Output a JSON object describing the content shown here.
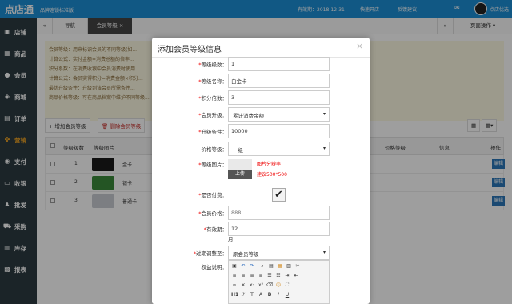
{
  "app": {
    "logo": "点店通",
    "subtitle": "品牌连锁标准版",
    "expiry": "有效期：2018-12-31",
    "quick_open": "快速开店",
    "feedback": "反馈建议",
    "user": "点店优选"
  },
  "sidebar": {
    "items": [
      {
        "label": "店铺",
        "icon": "shop-icon"
      },
      {
        "label": "商品",
        "icon": "goods-icon"
      },
      {
        "label": "会员",
        "icon": "member-icon"
      },
      {
        "label": "商城",
        "icon": "mall-icon"
      },
      {
        "label": "订单",
        "icon": "order-icon"
      },
      {
        "label": "营销",
        "icon": "marketing-icon"
      },
      {
        "label": "支付",
        "icon": "pay-icon"
      },
      {
        "label": "收银",
        "icon": "cashier-icon"
      },
      {
        "label": "批发",
        "icon": "wholesale-icon"
      },
      {
        "label": "采购",
        "icon": "purchase-icon"
      },
      {
        "label": "库存",
        "icon": "stock-icon"
      },
      {
        "label": "报表",
        "icon": "report-icon"
      }
    ],
    "active_color": "#f5a623"
  },
  "tabs": {
    "back": "«",
    "nav": "导航",
    "active": "会员等级",
    "close": "×",
    "forward": "»",
    "page_ops": "页面操作"
  },
  "info": {
    "lines": [
      "会员等级：用来标识会员的不同等级(如...",
      "计算公式：实付金额=消费总额的倍率...",
      "积分系数：在消费收银中会员消费时使用...",
      "计算公式：会员实得积分=消费金额×积分...",
      "最优升级条件：升级到该会员所需条件...",
      "商品价格等级：可在商品档案中维护不同等级..."
    ]
  },
  "toolbar": {
    "add": "增加会员等级",
    "delete": "删除会员等级"
  },
  "grid": {
    "headers": [
      "等级级数",
      "等级图片",
      "价格等级",
      "信息",
      "操作"
    ],
    "rows": [
      {
        "level": "1",
        "name": "金卡",
        "edit": "编辑"
      },
      {
        "level": "2",
        "name": "银卡",
        "edit": "编辑"
      },
      {
        "level": "3",
        "name": "普通卡",
        "edit": "编辑"
      }
    ]
  },
  "modal": {
    "title": "添加会员等级信息",
    "close": "×",
    "fields": {
      "level_num": {
        "label": "等级级数：",
        "value": "1"
      },
      "level_name": {
        "label": "等级名称：",
        "value": "白金卡"
      },
      "points_multiplier": {
        "label": "积分倍数：",
        "value": "3"
      },
      "upgrade_mode": {
        "label": "会员升级：",
        "value": "累计消费金额"
      },
      "upgrade_condition": {
        "label": "升级条件：",
        "value": "10000"
      },
      "price_level": {
        "label": "价格等级：",
        "value": "一级"
      },
      "level_image": {
        "label": "等级图片：",
        "upload": "上传",
        "hint1": "图片分辨率",
        "hint2": "建议500*500"
      },
      "is_paid": {
        "label": "是否付费：",
        "checked": "✔"
      },
      "member_price": {
        "label": "会员价格：",
        "value": "888"
      },
      "validity": {
        "label": "有效期：",
        "value": "12",
        "unit": "月"
      },
      "expiry_adjust": {
        "label": "过期调整至：",
        "value": "原会员等级"
      },
      "benefits": {
        "label": "权益说明："
      }
    }
  }
}
